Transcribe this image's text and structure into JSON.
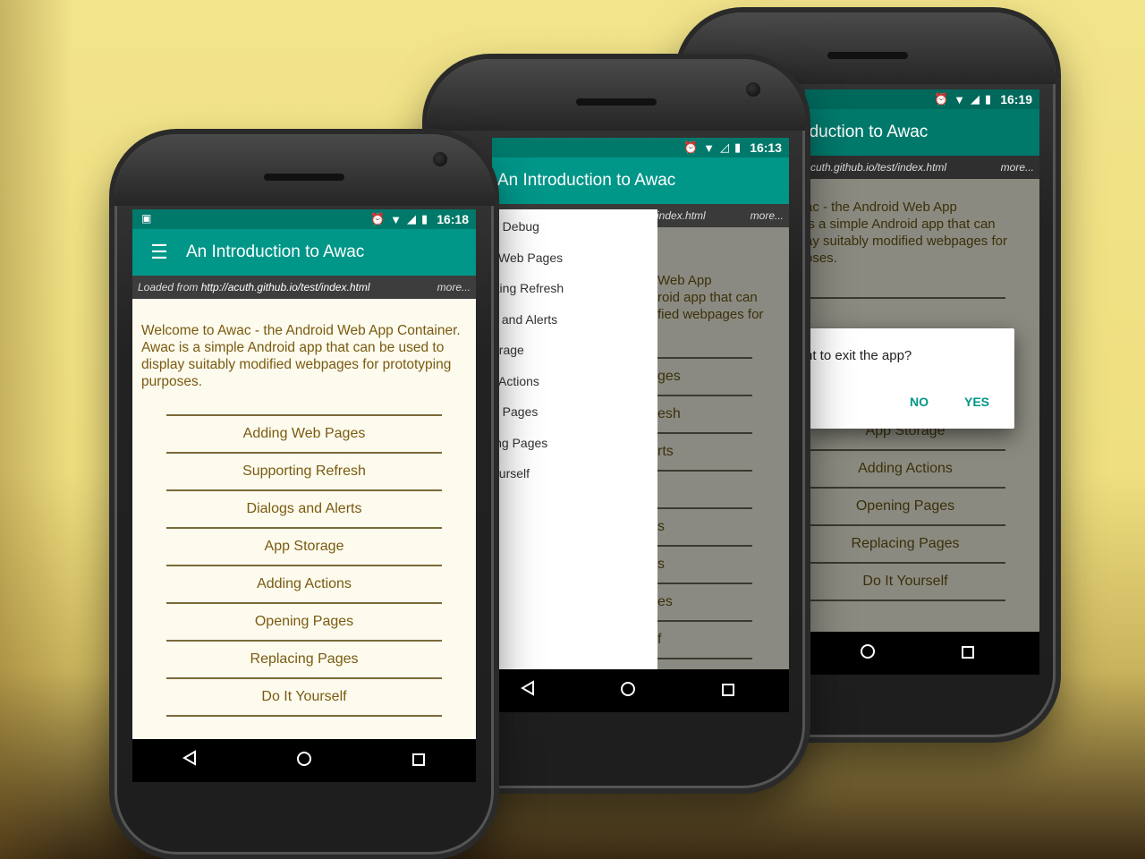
{
  "colors": {
    "primary": "#009688",
    "primary_dark": "#00796b",
    "content_text": "#7a5a10",
    "page_bg": "#fdfbee"
  },
  "phone1": {
    "status_time": "16:18",
    "app_title": "An Introduction to Awac",
    "url_prefix": "Loaded from ",
    "url": "http://acuth.github.io/test/index.html",
    "more": "more...",
    "intro": "Welcome to Awac - the Android Web App Container. Awac is a simple Android app that can be used to display suitably modified webpages for prototyping purposes.",
    "items": [
      "Adding Web Pages",
      "Supporting Refresh",
      "Dialogs and Alerts",
      "App Storage",
      "Adding Actions",
      "Opening Pages",
      "Replacing Pages",
      "Do It Yourself"
    ]
  },
  "phone2": {
    "status_time": "16:13",
    "app_title": "An Introduction to Awac",
    "url_fragment": "index.html",
    "more": "more...",
    "intro_lines": [
      "Web App",
      "roid app that can",
      "fied webpages for"
    ],
    "bg_items": [
      "ges",
      "esh",
      "rts",
      "",
      "s",
      "s",
      "es",
      "f"
    ],
    "drawer_items": [
      "e Debug",
      "Web Pages",
      "rting Refresh",
      "s and Alerts",
      "orage",
      "Actions",
      "g Pages",
      "ing Pages",
      "ourself"
    ]
  },
  "phone3": {
    "status_time": "16:19",
    "app_title": "oduction to Awac",
    "url_fragment": "cuth.github.io/test/index.html",
    "more": "more...",
    "intro": "ac - the Android Web App\nis a simple Android app that can\nay suitably modified webpages for\noses.",
    "dialog_text": "nt to exit the app?",
    "dialog_no": "NO",
    "dialog_yes": "YES",
    "items": [
      "App Storage",
      "Adding Actions",
      "Opening Pages",
      "Replacing Pages",
      "Do It Yourself"
    ]
  }
}
